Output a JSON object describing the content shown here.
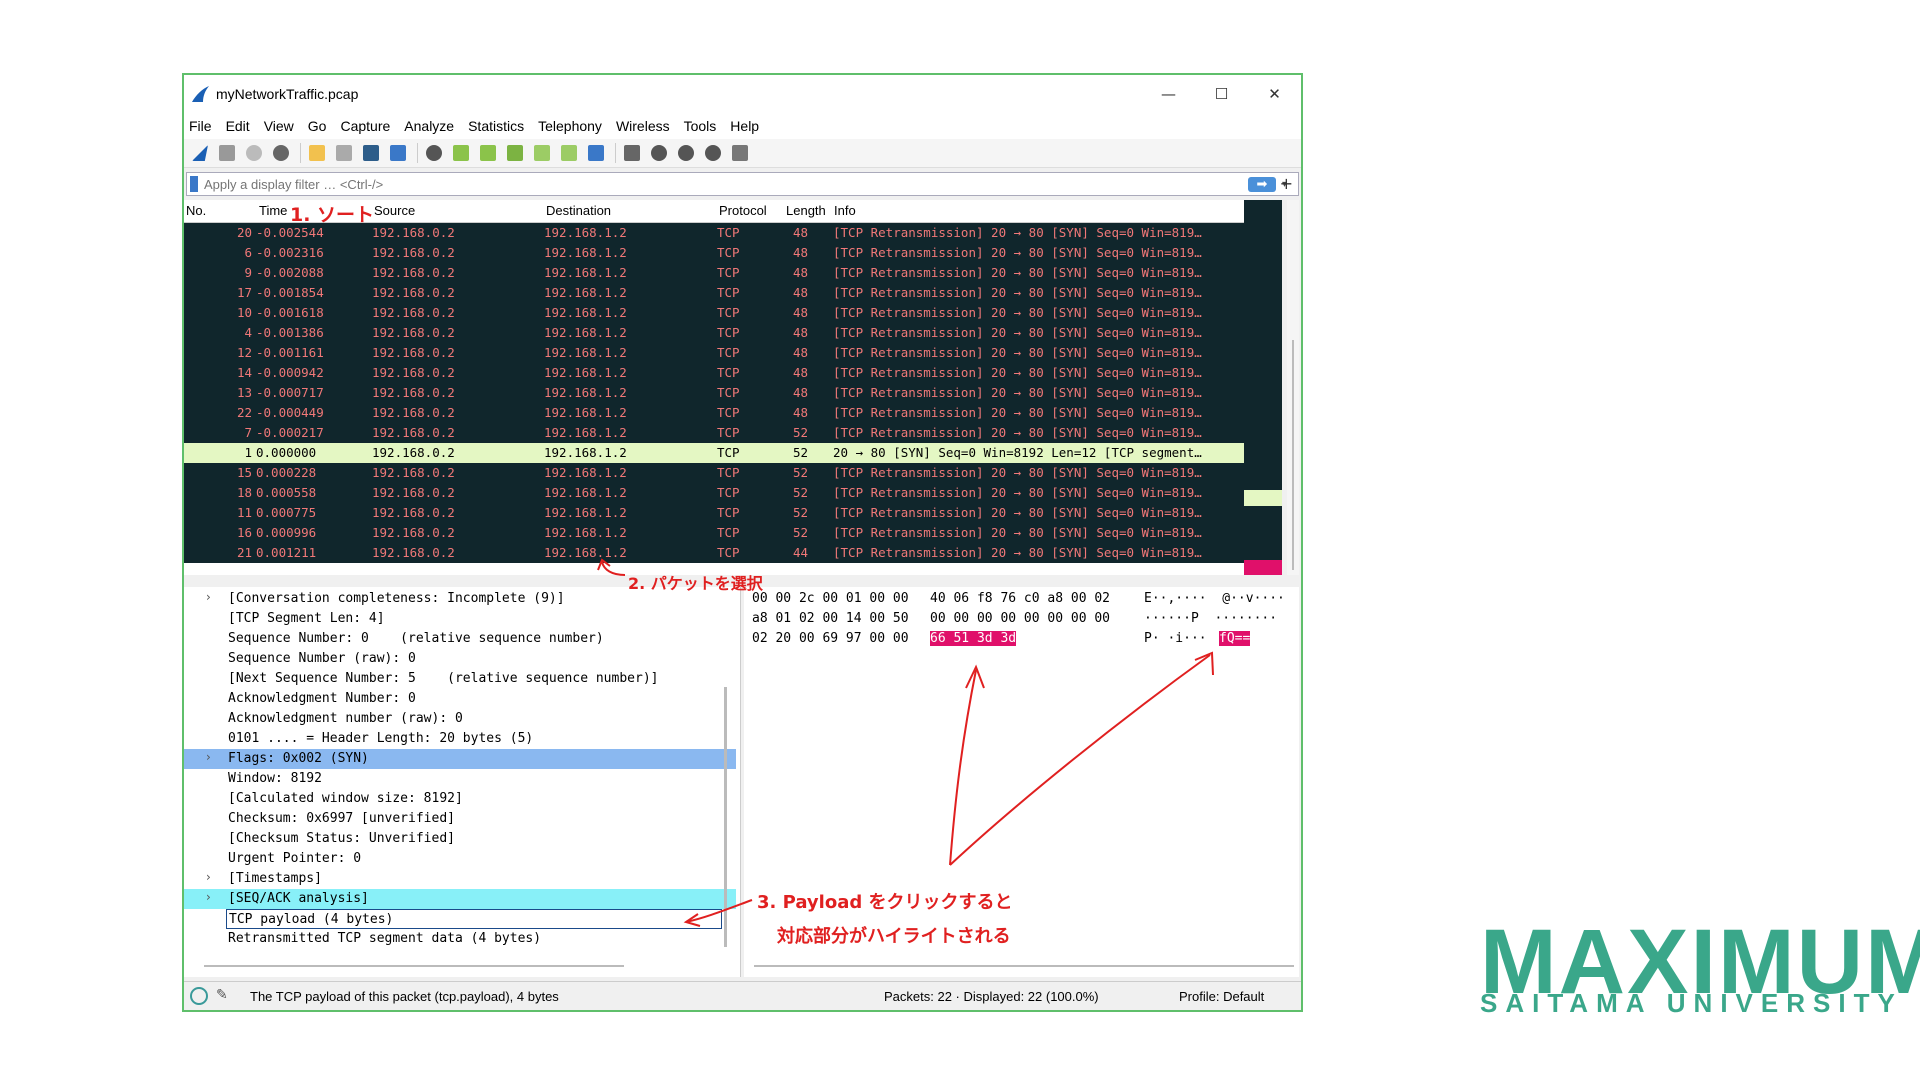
{
  "window": {
    "title": "myNetworkTraffic.pcap",
    "controls": {
      "minimize": "—",
      "maximize": "☐",
      "close": "✕"
    }
  },
  "menu": [
    "File",
    "Edit",
    "View",
    "Go",
    "Capture",
    "Analyze",
    "Statistics",
    "Telephony",
    "Wireless",
    "Tools",
    "Help"
  ],
  "filter": {
    "placeholder": "Apply a display filter … <Ctrl-/>",
    "apply": "➡",
    "dropdown": "▾",
    "add": "+"
  },
  "columns": {
    "no": "No.",
    "time": "Time",
    "source": "Source",
    "destination": "Destination",
    "protocol": "Protocol",
    "length": "Length",
    "info": "Info"
  },
  "packets": [
    {
      "no": "20",
      "time": "-0.002544",
      "src": "192.168.0.2",
      "dst": "192.168.1.2",
      "proto": "TCP",
      "len": "48",
      "info": "[TCP Retransmission] 20 → 80 [SYN] Seq=0 Win=819…"
    },
    {
      "no": "6",
      "time": "-0.002316",
      "src": "192.168.0.2",
      "dst": "192.168.1.2",
      "proto": "TCP",
      "len": "48",
      "info": "[TCP Retransmission] 20 → 80 [SYN] Seq=0 Win=819…"
    },
    {
      "no": "9",
      "time": "-0.002088",
      "src": "192.168.0.2",
      "dst": "192.168.1.2",
      "proto": "TCP",
      "len": "48",
      "info": "[TCP Retransmission] 20 → 80 [SYN] Seq=0 Win=819…"
    },
    {
      "no": "17",
      "time": "-0.001854",
      "src": "192.168.0.2",
      "dst": "192.168.1.2",
      "proto": "TCP",
      "len": "48",
      "info": "[TCP Retransmission] 20 → 80 [SYN] Seq=0 Win=819…"
    },
    {
      "no": "10",
      "time": "-0.001618",
      "src": "192.168.0.2",
      "dst": "192.168.1.2",
      "proto": "TCP",
      "len": "48",
      "info": "[TCP Retransmission] 20 → 80 [SYN] Seq=0 Win=819…"
    },
    {
      "no": "4",
      "time": "-0.001386",
      "src": "192.168.0.2",
      "dst": "192.168.1.2",
      "proto": "TCP",
      "len": "48",
      "info": "[TCP Retransmission] 20 → 80 [SYN] Seq=0 Win=819…"
    },
    {
      "no": "12",
      "time": "-0.001161",
      "src": "192.168.0.2",
      "dst": "192.168.1.2",
      "proto": "TCP",
      "len": "48",
      "info": "[TCP Retransmission] 20 → 80 [SYN] Seq=0 Win=819…"
    },
    {
      "no": "14",
      "time": "-0.000942",
      "src": "192.168.0.2",
      "dst": "192.168.1.2",
      "proto": "TCP",
      "len": "48",
      "info": "[TCP Retransmission] 20 → 80 [SYN] Seq=0 Win=819…"
    },
    {
      "no": "13",
      "time": "-0.000717",
      "src": "192.168.0.2",
      "dst": "192.168.1.2",
      "proto": "TCP",
      "len": "48",
      "info": "[TCP Retransmission] 20 → 80 [SYN] Seq=0 Win=819…"
    },
    {
      "no": "22",
      "time": "-0.000449",
      "src": "192.168.0.2",
      "dst": "192.168.1.2",
      "proto": "TCP",
      "len": "48",
      "info": "[TCP Retransmission] 20 → 80 [SYN] Seq=0 Win=819…"
    },
    {
      "no": "7",
      "time": "-0.000217",
      "src": "192.168.0.2",
      "dst": "192.168.1.2",
      "proto": "TCP",
      "len": "52",
      "info": "[TCP Retransmission] 20 → 80 [SYN] Seq=0 Win=819…"
    },
    {
      "no": "1",
      "time": "0.000000",
      "src": "192.168.0.2",
      "dst": "192.168.1.2",
      "proto": "TCP",
      "len": "52",
      "info": "20 → 80 [SYN] Seq=0 Win=8192 Len=12 [TCP segment…",
      "selected": true
    },
    {
      "no": "15",
      "time": "0.000228",
      "src": "192.168.0.2",
      "dst": "192.168.1.2",
      "proto": "TCP",
      "len": "52",
      "info": "[TCP Retransmission] 20 → 80 [SYN] Seq=0 Win=819…"
    },
    {
      "no": "18",
      "time": "0.000558",
      "src": "192.168.0.2",
      "dst": "192.168.1.2",
      "proto": "TCP",
      "len": "52",
      "info": "[TCP Retransmission] 20 → 80 [SYN] Seq=0 Win=819…"
    },
    {
      "no": "11",
      "time": "0.000775",
      "src": "192.168.0.2",
      "dst": "192.168.1.2",
      "proto": "TCP",
      "len": "52",
      "info": "[TCP Retransmission] 20 → 80 [SYN] Seq=0 Win=819…"
    },
    {
      "no": "16",
      "time": "0.000996",
      "src": "192.168.0.2",
      "dst": "192.168.1.2",
      "proto": "TCP",
      "len": "52",
      "info": "[TCP Retransmission] 20 → 80 [SYN] Seq=0 Win=819…"
    },
    {
      "no": "21",
      "time": "0.001211",
      "src": "192.168.0.2",
      "dst": "192.168.1.2",
      "proto": "TCP",
      "len": "44",
      "info": "[TCP Retransmission] 20 → 80 [SYN] Seq=0 Win=819…"
    }
  ],
  "details": [
    {
      "arrow": "›",
      "text": "[Conversation completeness: Incomplete (9)]"
    },
    {
      "arrow": "",
      "text": "[TCP Segment Len: 4]"
    },
    {
      "arrow": "",
      "text": "Sequence Number: 0    (relative sequence number)"
    },
    {
      "arrow": "",
      "text": "Sequence Number (raw): 0"
    },
    {
      "arrow": "",
      "text": "[Next Sequence Number: 5    (relative sequence number)]"
    },
    {
      "arrow": "",
      "text": "Acknowledgment Number: 0"
    },
    {
      "arrow": "",
      "text": "Acknowledgment number (raw): 0"
    },
    {
      "arrow": "",
      "text": "0101 .... = Header Length: 20 bytes (5)"
    },
    {
      "arrow": "›",
      "text": "Flags: 0x002 (SYN)",
      "style": "flags"
    },
    {
      "arrow": "",
      "text": "Window: 8192"
    },
    {
      "arrow": "",
      "text": "[Calculated window size: 8192]"
    },
    {
      "arrow": "",
      "text": "Checksum: 0x6997 [unverified]"
    },
    {
      "arrow": "",
      "text": "[Checksum Status: Unverified]"
    },
    {
      "arrow": "",
      "text": "Urgent Pointer: 0"
    },
    {
      "arrow": "›",
      "text": "[Timestamps]"
    },
    {
      "arrow": "›",
      "text": "[SEQ/ACK analysis]",
      "style": "seqack"
    },
    {
      "arrow": "",
      "text": "TCP payload (4 bytes)",
      "style": "payload"
    },
    {
      "arrow": "",
      "text": "Retransmitted TCP segment data (4 bytes)"
    }
  ],
  "hex": [
    {
      "a": "00 00 2c 00 01 00 00",
      "b": "40 06 f8 76 c0 a8 00 02",
      "ascii": "E··,····  @··v····"
    },
    {
      "a": "a8 01 02 00 14 00 50",
      "b": "00 00 00 00 00 00 00 00",
      "ascii": "······P  ········"
    },
    {
      "a": "02 20 00 69 97 00 00",
      "b": "66 51 3d 3d",
      "ascii": "P· ·i···",
      "ascii_hi": "fQ=="
    }
  ],
  "status": {
    "message": "The TCP payload of this packet (tcp.payload), 4 bytes",
    "packets": "Packets: 22 · Displayed: 22 (100.0%)",
    "profile": "Profile: Default"
  },
  "annotations": {
    "sort": "1. ソート",
    "select": "2. パケットを選択",
    "payload1": "3. Payload をクリックすると",
    "payload2": "対応部分がハイライトされる"
  },
  "logo": {
    "main": "MAXIMUM",
    "sub": "SAITAMA UNIVERSITY"
  },
  "colors": {
    "pkt_bg": "#10262c",
    "pkt_fg": "#f07878",
    "selected_row": "#e4f7c3",
    "highlight": "#e0106a",
    "annotation": "#e02020",
    "logo": "#3aa78a"
  }
}
